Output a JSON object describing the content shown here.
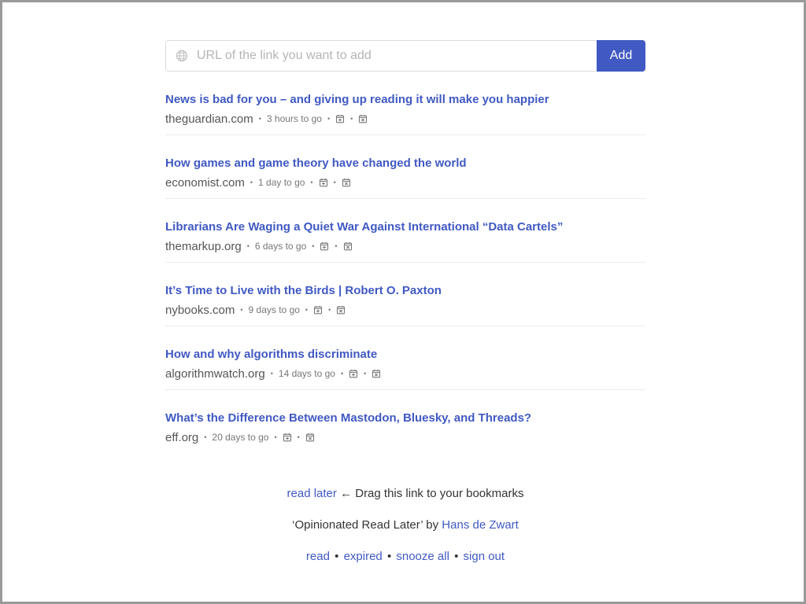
{
  "form": {
    "url_placeholder": "URL of the link you want to add",
    "add_label": "Add",
    "icon": "globe-icon"
  },
  "items": [
    {
      "title": "News is bad for you – and giving up reading it will make you happier",
      "domain": "theguardian.com",
      "due": "3 hours to go"
    },
    {
      "title": "How games and game theory have changed the world",
      "domain": "economist.com",
      "due": "1 day to go"
    },
    {
      "title": "Librarians Are Waging a Quiet War Against International “Data Cartels”",
      "domain": "themarkup.org",
      "due": "6 days to go"
    },
    {
      "title": "It’s Time to Live with the Birds | Robert O. Paxton",
      "domain": "nybooks.com",
      "due": "9 days to go"
    },
    {
      "title": "How and why algorithms discriminate",
      "domain": "algorithmwatch.org",
      "due": "14 days to go"
    },
    {
      "title": "What’s the Difference Between Mastodon, Bluesky, and Threads?",
      "domain": "eff.org",
      "due": "20 days to go"
    }
  ],
  "item_icons": [
    "calendar-plus-icon",
    "calendar-x-icon"
  ],
  "footer": {
    "bookmarklet_link": "read later",
    "bookmarklet_text": "← Drag this link to your bookmarks",
    "credit_text": "‘Opinionated Read Later’ by",
    "author_link": "Hans de Zwart",
    "nav": [
      "read",
      "expired",
      "snooze all",
      "sign out"
    ],
    "nav_separator": "•"
  },
  "colors": {
    "accent": "#4059c3",
    "muted_text": "#777777",
    "divider": "#ececec"
  }
}
